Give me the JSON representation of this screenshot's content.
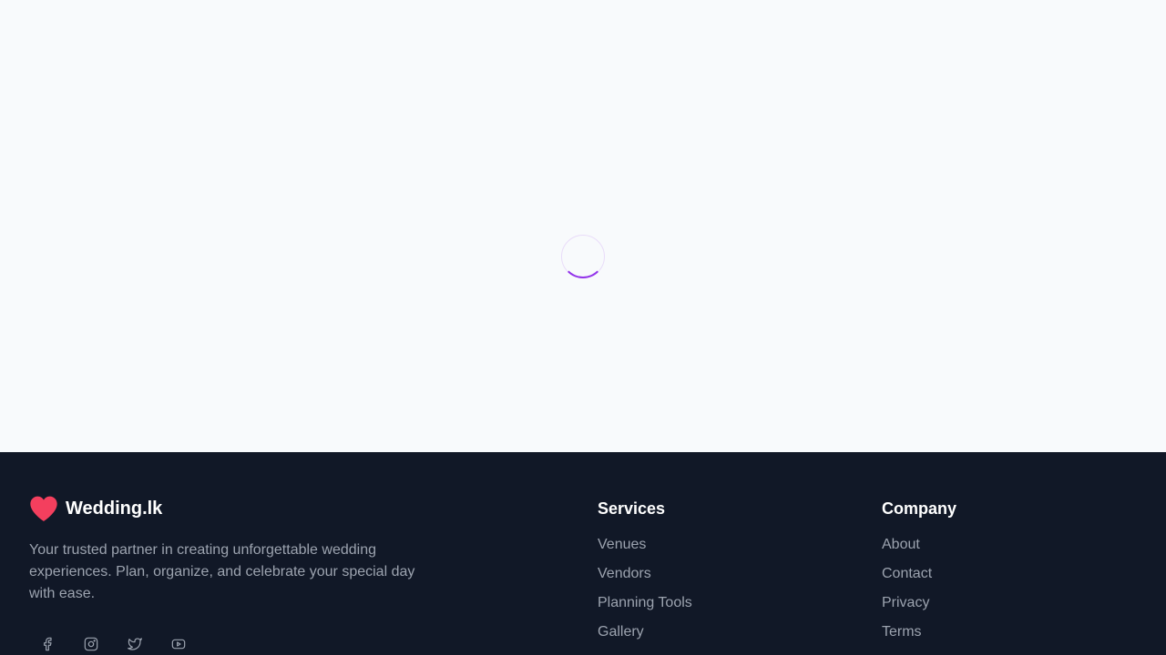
{
  "brand": {
    "name": "Wedding.lk",
    "tagline": "Your trusted partner in creating unforgettable wedding experiences. Plan, organize, and celebrate your special day with ease.",
    "icon": "heart-icon",
    "accent_color": "#f43f5e"
  },
  "loader": {
    "icon": "loading-spinner",
    "color": "#9333ea"
  },
  "socials": [
    {
      "icon": "facebook-icon"
    },
    {
      "icon": "instagram-icon"
    },
    {
      "icon": "twitter-icon"
    },
    {
      "icon": "youtube-icon"
    }
  ],
  "services": {
    "heading": "Services",
    "links": [
      "Venues",
      "Vendors",
      "Planning Tools",
      "Gallery"
    ]
  },
  "company": {
    "heading": "Company",
    "links": [
      "About",
      "Contact",
      "Privacy",
      "Terms"
    ]
  },
  "colors": {
    "page_bg": "#f8fafc",
    "footer_bg": "#111827",
    "muted_text": "#9ca3af"
  }
}
